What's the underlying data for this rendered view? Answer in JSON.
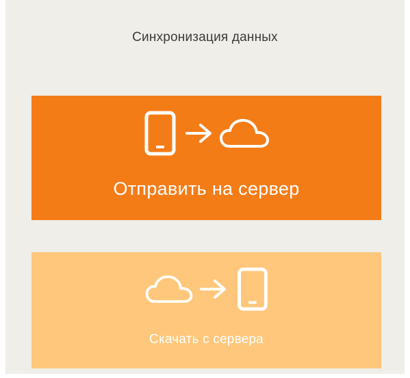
{
  "header": {
    "title": "Синхронизация данных"
  },
  "actions": {
    "upload": {
      "label": "Отправить на сервер",
      "icons": [
        "tablet-icon",
        "arrow-right-icon",
        "cloud-icon"
      ],
      "background": "#f47c17"
    },
    "download": {
      "label": "Скачать с сервера",
      "icons": [
        "cloud-icon",
        "arrow-right-icon",
        "tablet-icon"
      ],
      "background": "#fec77b"
    }
  },
  "colors": {
    "screen_background": "#efeee9",
    "title_text": "#3a3a3a",
    "button_text": "#ffffff"
  }
}
